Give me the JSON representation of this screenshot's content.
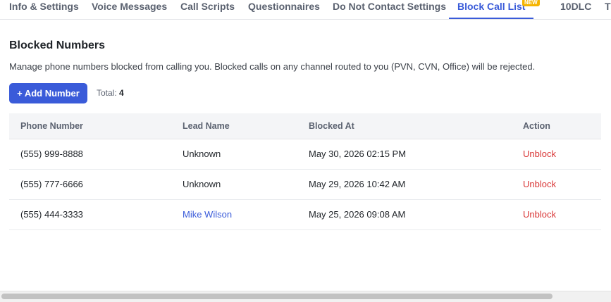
{
  "tabs": [
    {
      "label": "Info & Settings"
    },
    {
      "label": "Voice Messages"
    },
    {
      "label": "Call Scripts"
    },
    {
      "label": "Questionnaires"
    },
    {
      "label": "Do Not Contact Settings"
    },
    {
      "label": "Block Call List",
      "badge": "NEW",
      "active": true
    },
    {
      "label": "10DLC"
    },
    {
      "label": "T"
    }
  ],
  "section": {
    "title": "Blocked Numbers",
    "description": "Manage phone numbers blocked from calling you. Blocked calls on any channel routed to you (PVN, CVN, Office) will be rejected.",
    "add_button": "+ Add Number",
    "total_label": "Total:",
    "total_value": "4"
  },
  "table": {
    "headers": [
      "Phone Number",
      "Lead Name",
      "Blocked At",
      "Action"
    ],
    "rows": [
      {
        "phone": "(555) 999-8888",
        "lead": "Unknown",
        "blocked_at": "May 30, 2026 02:15 PM",
        "action": "Unblock"
      },
      {
        "phone": "(555) 777-6666",
        "lead": "Unknown",
        "blocked_at": "May 29, 2026 10:42 AM",
        "action": "Unblock"
      },
      {
        "phone": "(555) 444-3333",
        "lead": "Mike Wilson",
        "blocked_at": "May 25, 2026 09:08 AM",
        "action": "Unblock"
      }
    ]
  },
  "colors": {
    "accent": "#3a5bd9",
    "danger": "#d93636",
    "badge": "#f5b400"
  }
}
